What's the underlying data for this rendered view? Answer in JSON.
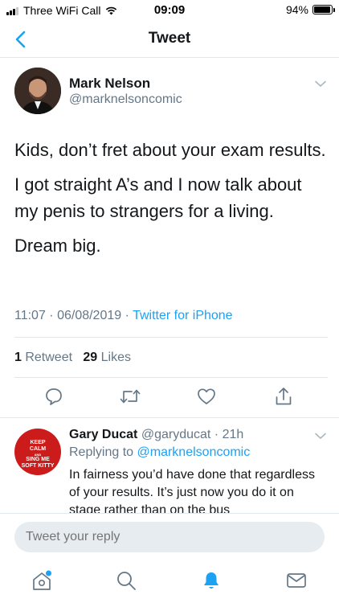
{
  "status_bar": {
    "carrier": "Three WiFi Call",
    "time": "09:09",
    "battery": "94%",
    "battery_level": 0.94
  },
  "nav": {
    "title": "Tweet"
  },
  "tweet": {
    "author_name": "Mark Nelson",
    "author_handle": "@marknelsoncomic",
    "paragraphs": [
      "Kids, don’t fret about your exam results.",
      "I got straight A’s and I now talk about my penis to strangers for a living.",
      "Dream big."
    ],
    "timestamp": "11:07 · 06/08/2019 · ",
    "source": "Twitter for iPhone",
    "retweet_count": "1",
    "retweet_label": " Retweet",
    "like_count": "29",
    "like_label": " Likes"
  },
  "reply": {
    "author_name": "Gary Ducat",
    "author_handle": "@garyducat",
    "time": " · 21h",
    "replying_prefix": "Replying to ",
    "replying_to": "@marknelsoncomic",
    "text": "In fairness you’d have done that regardless of your results. It’s just now you do it on stage rather than on the bus",
    "avatar_text": [
      "KEEP",
      "CALM",
      "AND",
      "SING ME",
      "SOFT KITTY"
    ]
  },
  "composer": {
    "placeholder": "Tweet your reply"
  },
  "colors": {
    "accent": "#1da1f2",
    "muted": "#657786",
    "text": "#14171a",
    "divider": "#e1e8ed"
  },
  "icons": {
    "actions": [
      "reply-icon",
      "retweet-icon",
      "like-icon",
      "share-icon"
    ],
    "tabs": [
      "home-icon",
      "search-icon",
      "notifications-icon",
      "messages-icon"
    ]
  }
}
